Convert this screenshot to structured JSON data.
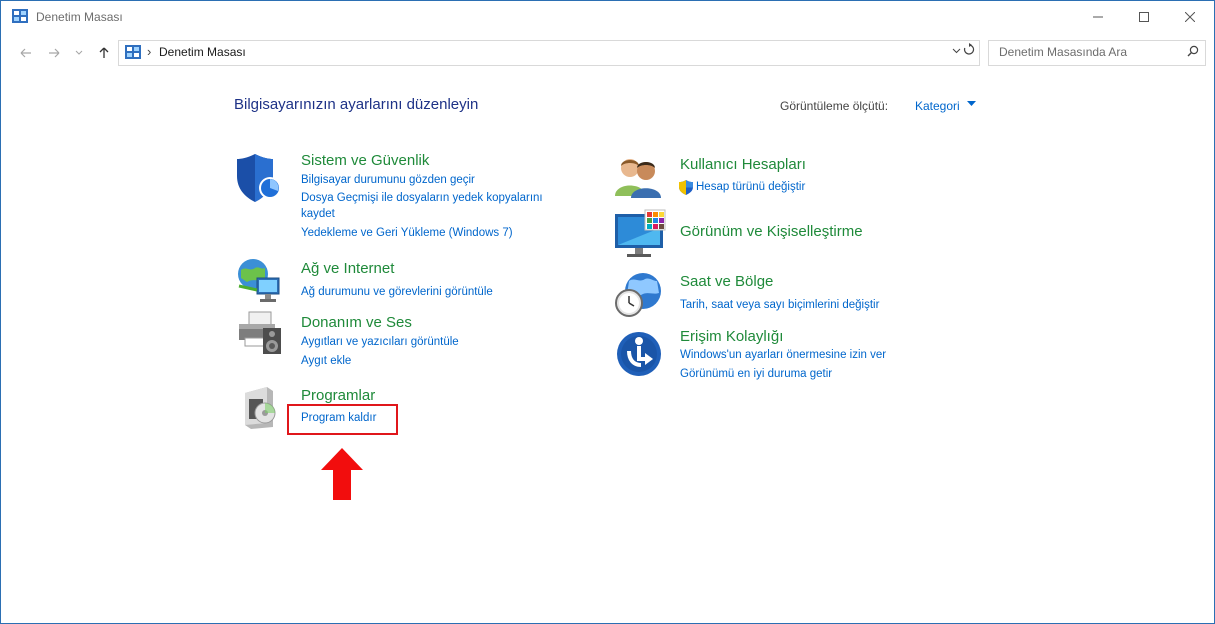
{
  "window": {
    "title": "Denetim Masası",
    "controls": {
      "minimize": "minimize-icon",
      "maximize": "maximize-icon",
      "close": "close-icon"
    }
  },
  "address": {
    "breadcrumb": "Denetim Masası",
    "separator": "›",
    "search_placeholder": "Denetim Masasında Ara"
  },
  "header": {
    "heading": "Bilgisayarınızın ayarlarını düzenleyin",
    "view_by_label": "Görüntüleme ölçütü:",
    "view_by_value": "Kategori"
  },
  "categories": [
    {
      "title": "Sistem ve Güvenlik",
      "icon": "shield-icon",
      "links": [
        "Bilgisayar durumunu gözden geçir",
        "Dosya Geçmişi ile dosyaların yedek kopyalarını",
        "kaydet",
        "Yedekleme ve Geri Yükleme (Windows 7)"
      ]
    },
    {
      "title": "Ağ ve Internet",
      "icon": "network-icon",
      "links": [
        "Ağ durumunu ve görevlerini görüntüle"
      ]
    },
    {
      "title": "Donanım ve Ses",
      "icon": "printer-speaker-icon",
      "links": [
        "Aygıtları ve yazıcıları görüntüle",
        "Aygıt ekle"
      ]
    },
    {
      "title": "Programlar",
      "icon": "programs-icon",
      "links": [
        "Program kaldır"
      ]
    },
    {
      "title": "Kullanıcı Hesapları",
      "icon": "users-icon",
      "links": [
        "Hesap türünü değiştir"
      ]
    },
    {
      "title": "Görünüm ve Kişiselleştirme",
      "icon": "monitor-palette-icon",
      "links": []
    },
    {
      "title": "Saat ve Bölge",
      "icon": "clock-globe-icon",
      "links": [
        "Tarih, saat veya sayı biçimlerini değiştir"
      ]
    },
    {
      "title": "Erişim Kolaylığı",
      "icon": "ease-of-access-icon",
      "links": [
        "Windows'un ayarları önermesine izin ver",
        "Görünümü en iyi duruma getir"
      ]
    }
  ],
  "annotation": {
    "color": "#e0161b"
  },
  "colors": {
    "heading": "#1e3287",
    "category": "#1f8a3a",
    "link": "#0066cc"
  }
}
